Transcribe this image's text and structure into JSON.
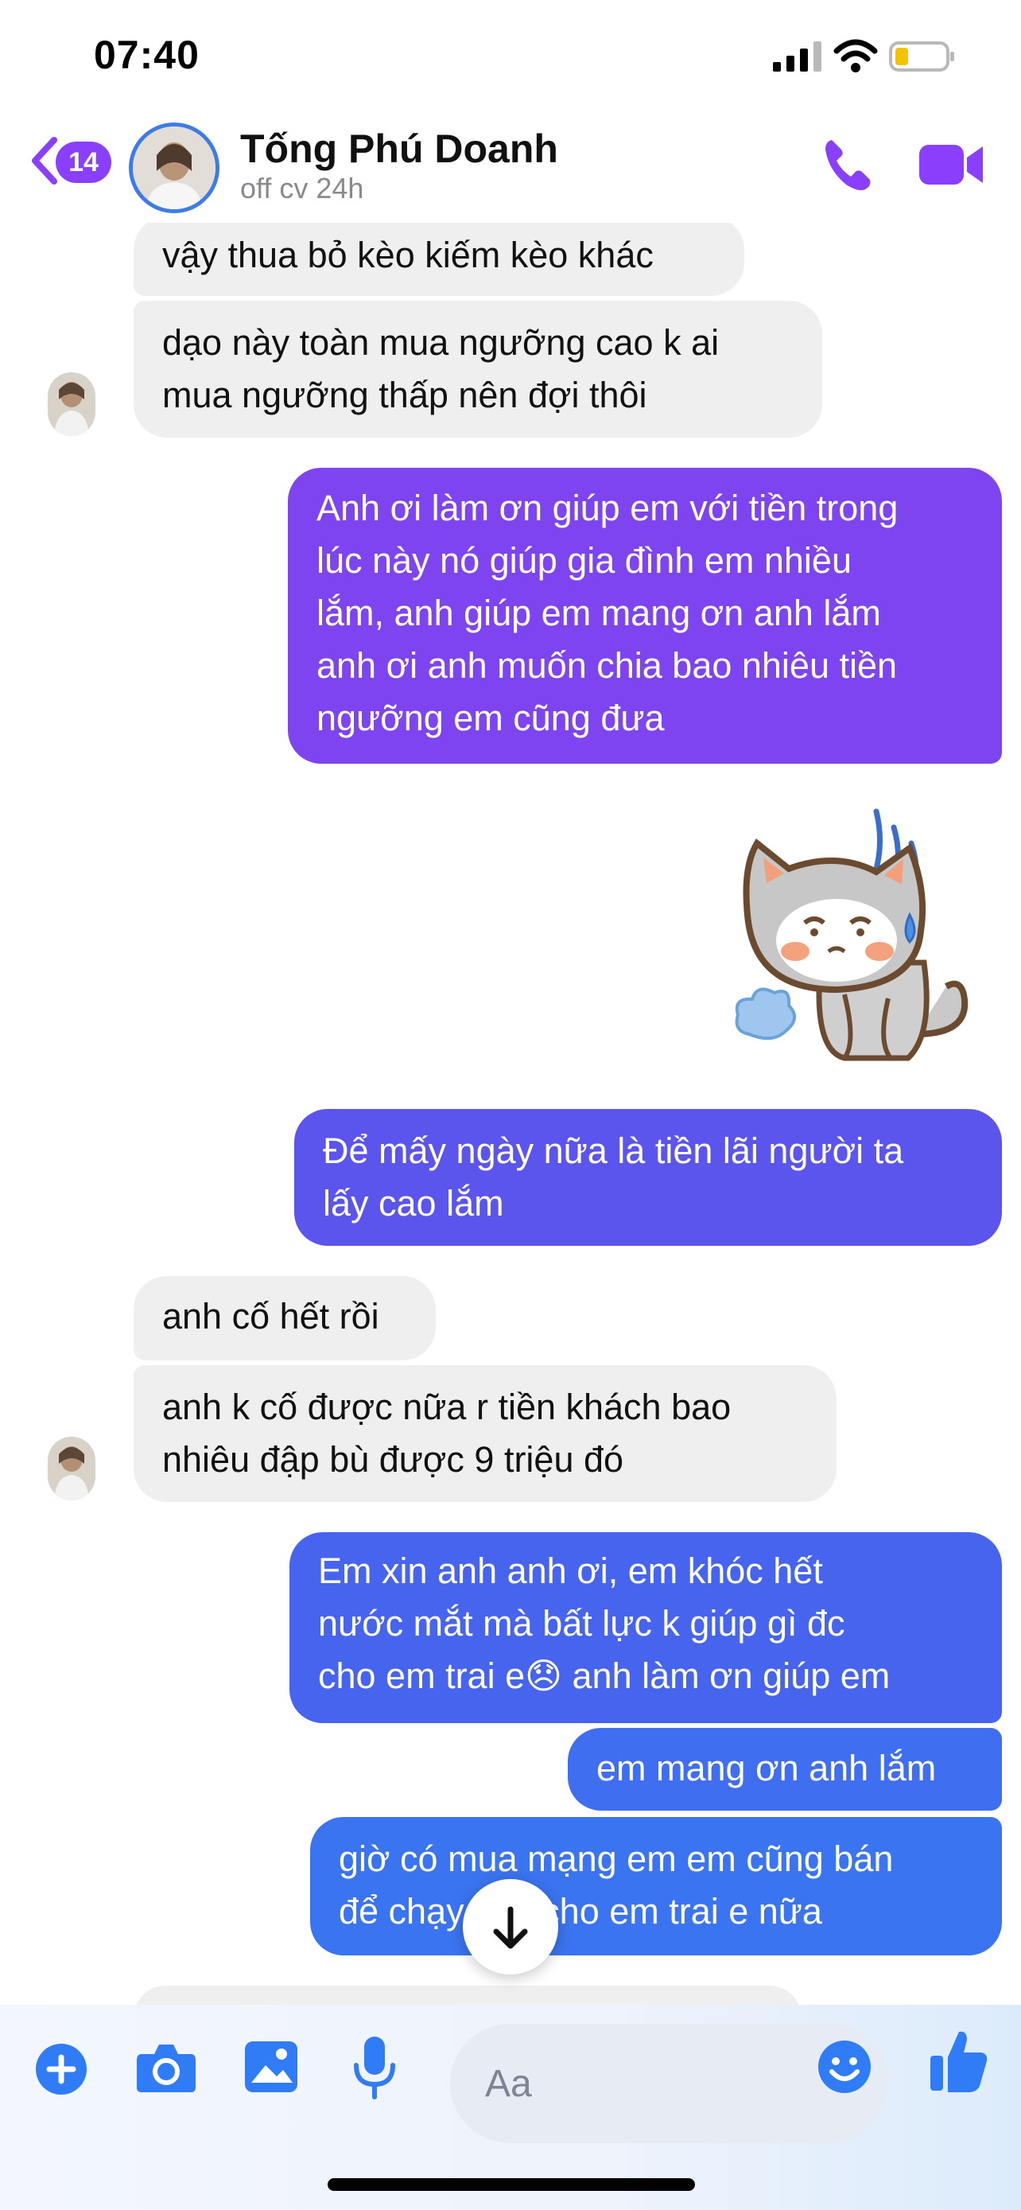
{
  "status_bar": {
    "time": "07:40"
  },
  "header": {
    "back_badge": "14",
    "contact_name": "Tống Phú Doanh",
    "contact_status": "off cv 24h"
  },
  "messages": [
    {
      "direction": "in",
      "lines": [
        "vậy thua bỏ kèo kiếm kèo khác"
      ]
    },
    {
      "direction": "in",
      "lines": [
        "dạo này toàn mua ngưỡng cao k ai",
        "mua ngưỡng thấp nên đợi thôi"
      ]
    },
    {
      "direction": "out",
      "lines": [
        "Anh ơi làm ơn giúp em với tiền trong",
        "lúc này nó giúp gia đình em nhiều",
        "lắm, anh giúp em mang ơn anh lắm",
        "anh ơi anh muốn chia bao nhiêu tiền",
        "ngưỡng em cũng đưa"
      ]
    },
    {
      "direction": "out",
      "lines": [
        "Để mấy ngày nữa là tiền lãi người ta",
        "lấy cao lắm"
      ]
    },
    {
      "direction": "in",
      "lines": [
        "anh cố hết rồi"
      ]
    },
    {
      "direction": "in",
      "lines": [
        "anh k cố được nữa r tiền khách bao",
        "nhiêu đập bù được 9 triệu đó"
      ]
    },
    {
      "direction": "out",
      "lines": [
        "Em xin anh anh ơi, em khóc hết",
        "nước mắt mà bất lực k giúp gì đc",
        "cho em trai e😞 anh làm ơn giúp em"
      ]
    },
    {
      "direction": "out",
      "lines": [
        "em mang ơn anh lắm"
      ]
    },
    {
      "direction": "out",
      "lines": [
        "giờ có mua mạng em em cũng bán",
        "để chạy tiền cho em trai e nữa"
      ]
    }
  ],
  "composer": {
    "placeholder": "Aa"
  },
  "colors": {
    "accent_purple": "#8a3ffc",
    "bubble_out_top": "#7e44f0",
    "bubble_out_mid": "#5b55ee",
    "bubble_out_bottom": "#3f6ff0",
    "bubble_in": "#efefef",
    "icon_blue": "#2f7cf6"
  },
  "icons": {
    "back": "chevron-left-icon",
    "call": "phone-icon",
    "video": "video-camera-icon",
    "sticker": "crying-cat-sticker",
    "scroll": "arrow-down-icon",
    "add": "plus-icon",
    "camera": "camera-icon",
    "gallery": "image-icon",
    "mic": "microphone-icon",
    "emoji": "smiley-icon",
    "like": "thumbs-up-icon"
  }
}
